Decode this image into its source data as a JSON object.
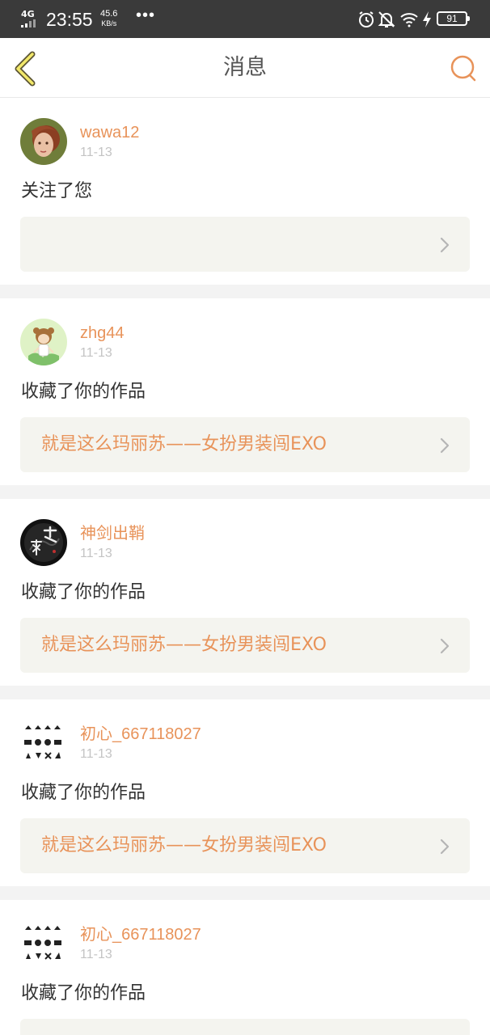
{
  "status_bar": {
    "network": "4G",
    "time": "23:55",
    "speed_value": "45.6",
    "speed_unit": "KB/s",
    "more": "•••",
    "battery": "91"
  },
  "header": {
    "back_icon": "chevron-left-icon",
    "title": "消息",
    "search_icon": "search-icon",
    "accent_color": "#e8935a"
  },
  "notifications": [
    {
      "username": "wawa12",
      "date": "11-13",
      "action": "关注了您",
      "work_title": ""
    },
    {
      "username": "zhg44",
      "date": "11-13",
      "action": "收藏了你的作品",
      "work_title": "就是这么玛丽苏——女扮男装闯EXO"
    },
    {
      "username": "神剑出鞘",
      "date": "11-13",
      "action": "收藏了你的作品",
      "work_title": "就是这么玛丽苏——女扮男装闯EXO"
    },
    {
      "username": "初心_667118027",
      "date": "11-13",
      "action": "收藏了你的作品",
      "work_title": "就是这么玛丽苏——女扮男装闯EXO"
    },
    {
      "username": "初心_667118027",
      "date": "11-13",
      "action": "收藏了你的作品",
      "work_title": ""
    }
  ]
}
